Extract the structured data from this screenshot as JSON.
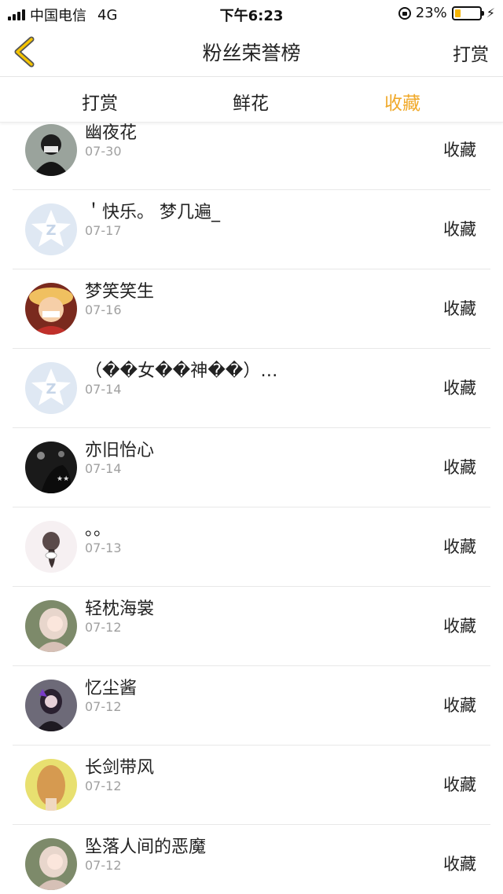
{
  "status_bar": {
    "carrier": "中国电信",
    "network": "4G",
    "time": "下午6:23",
    "battery": "23%",
    "battery_level": 0.23
  },
  "header": {
    "title": "粉丝荣誉榜",
    "action_label": "打赏"
  },
  "tabs": [
    {
      "label": "打赏",
      "active": false
    },
    {
      "label": "鲜花",
      "active": false
    },
    {
      "label": "收藏",
      "active": true
    }
  ],
  "accent_color": "#f0a92a",
  "fans": [
    {
      "name": "幽夜花",
      "date": "07-30",
      "action": "收藏",
      "avatar": "user-avatar-dark"
    },
    {
      "name": "＇快乐。 梦几遍_",
      "date": "07-17",
      "action": "收藏",
      "avatar": "default-qq-avatar"
    },
    {
      "name": "梦笑笑生",
      "date": "07-16",
      "action": "收藏",
      "avatar": "user-avatar-anime"
    },
    {
      "name": "（��女��神��）…",
      "date": "07-14",
      "action": "收藏",
      "avatar": "default-qq-avatar"
    },
    {
      "name": "亦旧怡心",
      "date": "07-14",
      "action": "收藏",
      "avatar": "user-avatar-night"
    },
    {
      "name": "。。",
      "date": "07-13",
      "action": "收藏",
      "avatar": "user-avatar-girl"
    },
    {
      "name": "轻枕海裳",
      "date": "07-12",
      "action": "收藏",
      "avatar": "user-avatar-anime-girl"
    },
    {
      "name": "忆尘酱",
      "date": "07-12",
      "action": "收藏",
      "avatar": "user-avatar-purple"
    },
    {
      "name": "长剑带风",
      "date": "07-12",
      "action": "收藏",
      "avatar": "user-avatar-blonde"
    },
    {
      "name": "坠落人间的恶魔",
      "date": "07-12",
      "action": "收藏",
      "avatar": "user-avatar-anime-girl"
    }
  ]
}
